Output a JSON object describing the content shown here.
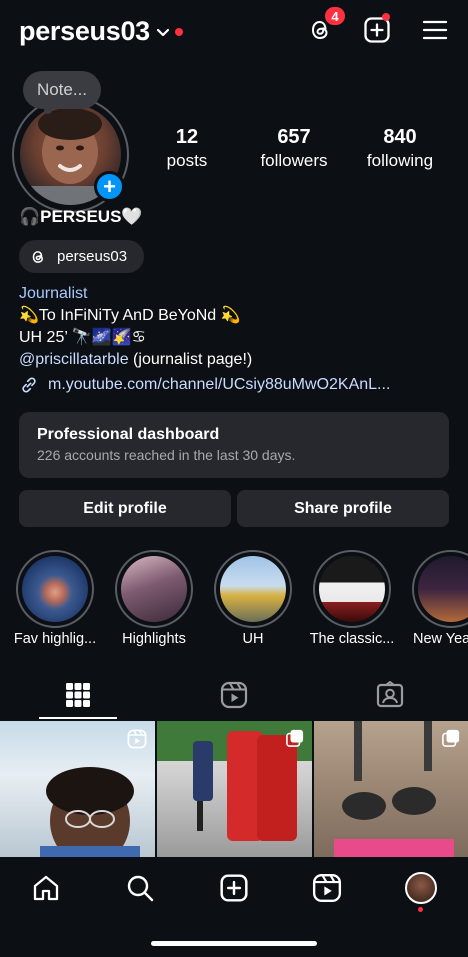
{
  "header": {
    "username": "perseus03",
    "threads_badge_count": "4",
    "icons": [
      "threads-icon",
      "create-icon",
      "menu-icon"
    ]
  },
  "profile": {
    "note_placeholder": "Note...",
    "add_story_symbol": "+",
    "stats": [
      {
        "value": "12",
        "label": "posts"
      },
      {
        "value": "657",
        "label": "followers"
      },
      {
        "value": "840",
        "label": "following"
      }
    ],
    "display_name": "🎧PERSEUS🤍",
    "threads_handle": "perseus03"
  },
  "bio": {
    "category": "Journalist",
    "line1": "💫To InFiNiTy AnD BeYoNd 💫",
    "line2": "UH 25’ 🔭🌌🌠♋",
    "mention": "@priscillatarble",
    "mention_suffix": " (journalist page!)",
    "link": "m.youtube.com/channel/UCsiy88uMwO2KAnL..."
  },
  "dashboard": {
    "title": "Professional dashboard",
    "subtitle": "226 accounts reached in the last 30 days."
  },
  "actions": {
    "edit": "Edit profile",
    "share": "Share profile"
  },
  "highlights": [
    {
      "label": "Fav highlig..."
    },
    {
      "label": "Highlights"
    },
    {
      "label": "UH"
    },
    {
      "label": "The classic..."
    },
    {
      "label": "New Yea"
    }
  ],
  "tabs": [
    "grid-tab",
    "reels-tab",
    "tagged-tab"
  ],
  "nav": [
    "home",
    "search",
    "create",
    "reels",
    "profile"
  ],
  "colors": {
    "background": "#0c0f14",
    "card": "#26282d",
    "accent_blue": "#0095f6",
    "notification_red": "#ff3040",
    "link": "#c9dbff"
  }
}
